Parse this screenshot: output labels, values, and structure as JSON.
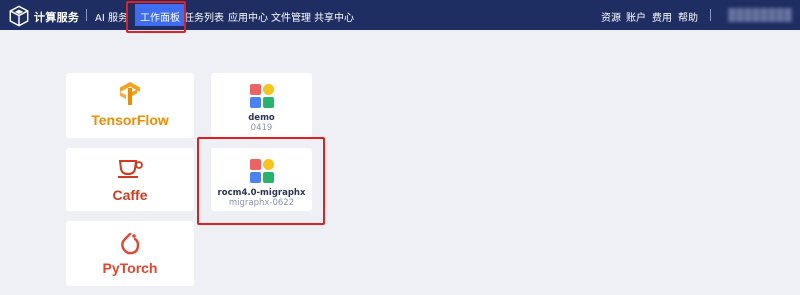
{
  "header": {
    "brand": "计算服务",
    "nav": [
      {
        "label": "AI 服务"
      },
      {
        "label": "工作面板"
      },
      {
        "label": "任务列表"
      },
      {
        "label": "应用中心"
      },
      {
        "label": "文件管理"
      },
      {
        "label": "共享中心"
      }
    ],
    "right_menu": [
      {
        "label": "资源"
      },
      {
        "label": "账户"
      },
      {
        "label": "费用"
      },
      {
        "label": "帮助"
      }
    ],
    "active_nav": "工作面板",
    "colors": {
      "bar": "#1e2e63",
      "active": "#3e6df2",
      "highlight": "#e02020"
    }
  },
  "frameworks": [
    {
      "name": "TensorFlow",
      "icon": "tensorflow-icon",
      "color": "#f08c00"
    },
    {
      "name": "Caffe",
      "icon": "caffe-icon",
      "color": "#d23b1f"
    },
    {
      "name": "PyTorch",
      "icon": "pytorch-icon",
      "color": "#e8432e"
    }
  ],
  "apps": [
    {
      "name": "demo",
      "subtitle": "0419",
      "icon": "app-grid-icon"
    },
    {
      "name": "rocm4.0-migraphx",
      "subtitle": "migraphx-0622",
      "icon": "app-grid-icon"
    }
  ]
}
